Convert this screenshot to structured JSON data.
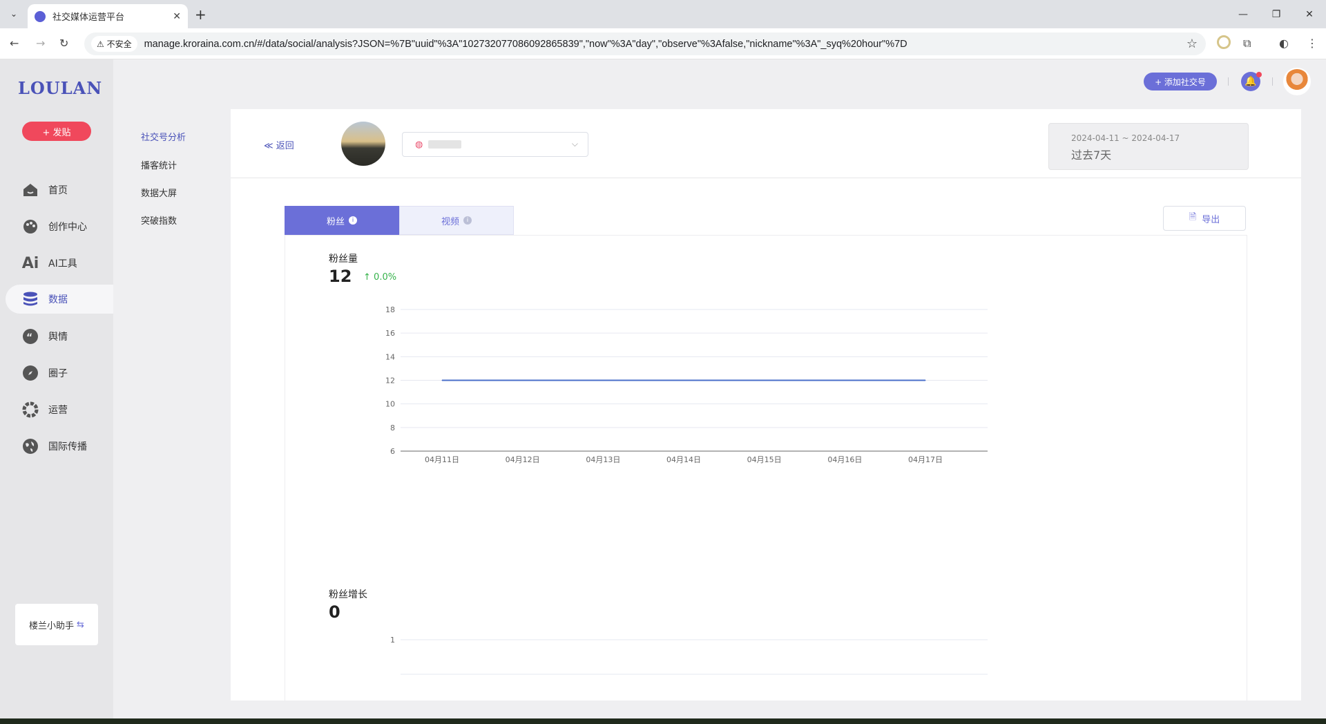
{
  "browser": {
    "tab_title": "社交媒体运营平台",
    "security_label": "不安全",
    "url": "manage.kroraina.com.cn/#/data/social/analysis?JSON=%7B\"uuid\"%3A\"102732077086092865839\",\"now\"%3A\"day\",\"observe\"%3Afalse,\"nickname\"%3A\"_syq%20hour\"%7D"
  },
  "sidebar": {
    "logo": "LOULAN",
    "post_button": "+ 发贴",
    "items": [
      {
        "label": "首页",
        "icon": "home-icon"
      },
      {
        "label": "创作中心",
        "icon": "palette-icon"
      },
      {
        "label": "AI工具",
        "icon": "ai-icon"
      },
      {
        "label": "数据",
        "icon": "database-icon",
        "active": true
      },
      {
        "label": "舆情",
        "icon": "quote-icon"
      },
      {
        "label": "圈子",
        "icon": "compass-icon"
      },
      {
        "label": "运营",
        "icon": "gear-icon"
      },
      {
        "label": "国际传播",
        "icon": "globe-icon"
      }
    ],
    "helper": "楼兰小助手"
  },
  "submenu": {
    "items": [
      "社交号分析",
      "播客统计",
      "数据大屏",
      "突破指数"
    ],
    "active_index": 0
  },
  "topbar": {
    "add_social": "+ 添加社交号"
  },
  "header": {
    "back": "≪ 返回",
    "date_range": "2024-04-11 ~ 2024-04-17",
    "date_label": "过去7天"
  },
  "tabs": [
    {
      "label": "粉丝",
      "active": true
    },
    {
      "label": "视频",
      "active": false
    }
  ],
  "export": "导出",
  "metrics": {
    "fans": {
      "label": "粉丝量",
      "value": "12",
      "change": "0.0%"
    },
    "growth": {
      "label": "粉丝增长",
      "value": "0"
    }
  },
  "chart_data": [
    {
      "type": "line",
      "title": "",
      "x": [
        "04月11日",
        "04月12日",
        "04月13日",
        "04月14日",
        "04月15日",
        "04月16日",
        "04月17日"
      ],
      "series": [
        {
          "values": [
            12,
            12,
            12,
            12,
            12,
            12,
            12
          ],
          "color": "#4a6fc9"
        }
      ],
      "yticks": [
        6,
        8,
        10,
        12,
        14,
        16,
        18
      ],
      "ylim": [
        6,
        18
      ],
      "grid": true
    },
    {
      "type": "line",
      "title": "",
      "x": [],
      "series": [],
      "yticks": [
        1
      ],
      "grid": true
    }
  ],
  "colors": {
    "accent": "#6b6fd8",
    "brand": "#4a52b8",
    "post": "#f0485c",
    "positive": "#35b24a"
  }
}
